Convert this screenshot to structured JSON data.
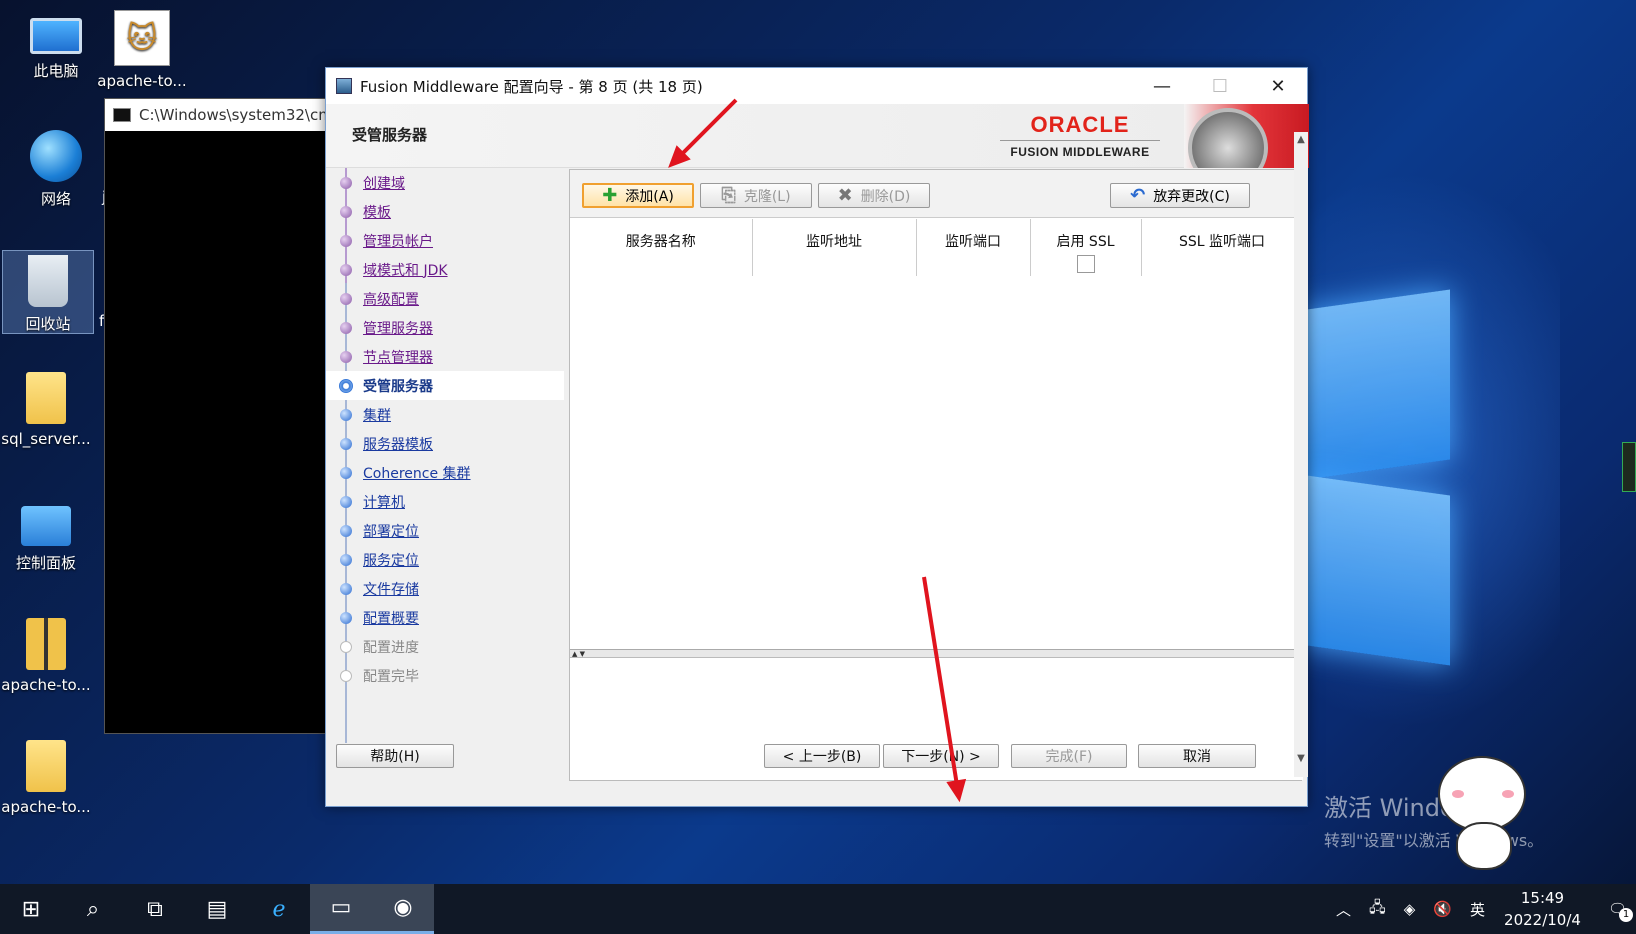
{
  "desktop": {
    "icons": [
      {
        "label": "此电脑"
      },
      {
        "label": "apache-to..."
      },
      {
        "label": "网络"
      },
      {
        "label": "回收站"
      },
      {
        "label": "sql_server..."
      },
      {
        "label": "控制面板"
      },
      {
        "label": "apache-to..."
      },
      {
        "label": "apache-to..."
      }
    ],
    "stray_letters": [
      "j",
      "f"
    ],
    "watermark_line1": "激活 Windows",
    "watermark_line2": "转到\"设置\"以激活 Windows。"
  },
  "cmd": {
    "title": "C:\\Windows\\system32\\cm"
  },
  "wizard": {
    "title": "Fusion Middleware 配置向导 - 第 8 页 (共 18 页)",
    "page_heading": "受管服务器",
    "brand_line1": "ORACLE",
    "brand_line2": "FUSION MIDDLEWARE",
    "steps": [
      {
        "label": "创建域",
        "state": "done"
      },
      {
        "label": "模板",
        "state": "done"
      },
      {
        "label": "管理员帐户",
        "state": "done"
      },
      {
        "label": "域模式和 JDK",
        "state": "done"
      },
      {
        "label": "高级配置",
        "state": "done"
      },
      {
        "label": "管理服务器",
        "state": "done"
      },
      {
        "label": "节点管理器",
        "state": "done"
      },
      {
        "label": "受管服务器",
        "state": "current"
      },
      {
        "label": "集群",
        "state": "todo"
      },
      {
        "label": "服务器模板",
        "state": "todo"
      },
      {
        "label": "Coherence 集群",
        "state": "todo"
      },
      {
        "label": "计算机",
        "state": "todo"
      },
      {
        "label": "部署定位",
        "state": "todo"
      },
      {
        "label": "服务定位",
        "state": "todo"
      },
      {
        "label": "文件存储",
        "state": "todo"
      },
      {
        "label": "配置概要",
        "state": "todo"
      },
      {
        "label": "配置进度",
        "state": "disabled"
      },
      {
        "label": "配置完毕",
        "state": "disabled"
      }
    ],
    "toolbar": {
      "add": "添加(A)",
      "clone": "克隆(L)",
      "delete": "删除(D)",
      "discard": "放弃更改(C)"
    },
    "table": {
      "columns": [
        "服务器名称",
        "监听地址",
        "监听端口",
        "启用 SSL",
        "SSL 监听端口"
      ],
      "rows": []
    },
    "buttons": {
      "help": "帮助(H)",
      "back": "< 上一步(B)",
      "next": "下一步(N) >",
      "finish": "完成(F)",
      "cancel": "取消"
    }
  },
  "taskbar": {
    "ime": "英",
    "time": "15:49",
    "date": "2022/10/4",
    "notify_count": "1"
  },
  "colors": {
    "oracle_red": "#e2231a",
    "arrow_red": "#e0141e",
    "done_step": "#6a1a8a",
    "todo_step": "#1a3aa0"
  }
}
